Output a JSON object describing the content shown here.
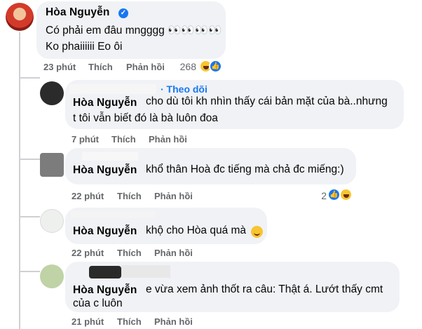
{
  "comments": [
    {
      "author": "Hòa Nguyễn",
      "verified": true,
      "lines": [
        "Có phải em đâu mngggg 👀👀👀👀",
        "Ko phaiiiiii Eo ôi"
      ],
      "time": "23 phút",
      "like": "Thích",
      "reply": "Phản hồi",
      "reaction_count": "268"
    },
    {
      "follow_label": "· Theo dõi",
      "author": "Hòa Nguyễn",
      "lines": [
        "cho dù tôi kh nhìn thấy cái bản mặt của bà..nhưng",
        "t tôi vẫn biết đó là bà luôn đoa"
      ],
      "time": "7 phút",
      "like": "Thích",
      "reply": "Phản hồi"
    },
    {
      "author": "Hòa Nguyễn",
      "lines": [
        "khổ thân Hoà đc tiếng mà chả đc miếng:)"
      ],
      "time": "22 phút",
      "like": "Thích",
      "reply": "Phản hồi",
      "reaction_count": "2"
    },
    {
      "author": "Hòa Nguyễn",
      "lines": [
        "khộ cho Hòa quá mà"
      ],
      "time": "22 phút",
      "like": "Thích",
      "reply": "Phản hồi"
    },
    {
      "author": "Hòa Nguyễn",
      "lines": [
        "e vừa xem ảnh thốt ra câu: Thật á. Lướt thấy cmt",
        "của c luôn"
      ],
      "time": "21 phút",
      "like": "Thích",
      "reply": "Phản hồi"
    }
  ],
  "icons": {
    "verified": "verified-badge-icon",
    "haha": "haha-reaction-icon",
    "like": "like-reaction-icon",
    "smile": "smile-emoji-icon"
  },
  "colors": {
    "bubble": "#f0f2f5",
    "meta_text": "#65676b",
    "accent": "#1877f2"
  }
}
